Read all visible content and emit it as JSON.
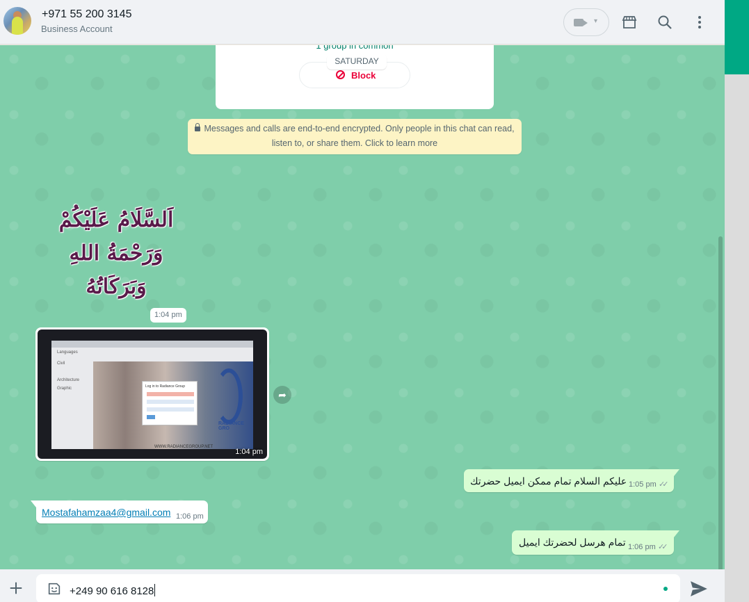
{
  "header": {
    "contact_name": "+971 55 200 3145",
    "contact_subtitle": "Business Account"
  },
  "info_card": {
    "common_groups": "1 group in common",
    "block_label": "Block"
  },
  "date_separator": "SATURDAY",
  "encryption_notice": {
    "line1": "Messages and calls are end-to-end encrypted. Only people in this chat can read,",
    "line2": "listen to, or share them. Click to learn more"
  },
  "messages": [
    {
      "type": "sticker",
      "direction": "in",
      "line1": "اَلسَّلَامُ عَلَيْكُمْ",
      "line2": "وَرَحْمَةُ اللهِ وَبَرَكَاتُهُ",
      "time": "1:04 pm"
    },
    {
      "type": "image",
      "direction": "in",
      "time": "1:04 pm",
      "image_text": {
        "dialog_title": "Log in to Radiance Group",
        "url": "WWW.RADIANCEGROUP.NET",
        "labels": [
          "Languages",
          "Civil",
          "Architecture",
          "Graphic"
        ],
        "brand": "RADIANCE GRO"
      }
    },
    {
      "type": "text",
      "direction": "out",
      "text": "عليكم السلام تمام ممكن ايميل حضرتك",
      "time": "1:05 pm",
      "status": "read"
    },
    {
      "type": "text",
      "direction": "in",
      "text": "Mostafahamzaa4@gmail.com",
      "time": "1:06 pm"
    },
    {
      "type": "text",
      "direction": "out",
      "text": "تمام هرسل لحضرتك ايميل",
      "time": "1:06 pm",
      "status": "read"
    }
  ],
  "composer": {
    "value": "+249 90 616 8128"
  },
  "colors": {
    "accent": "#00a884",
    "chat_background": "#7fceaa",
    "outgoing_bubble": "#d9fdd3",
    "encryption_banner": "#fdf4c5",
    "block_red": "#ea0038"
  },
  "icons": {
    "header": [
      "video-call-icon",
      "catalog-icon",
      "search-icon",
      "menu-icon"
    ],
    "footer": [
      "plus-icon",
      "sticker-icon",
      "send-icon"
    ]
  }
}
